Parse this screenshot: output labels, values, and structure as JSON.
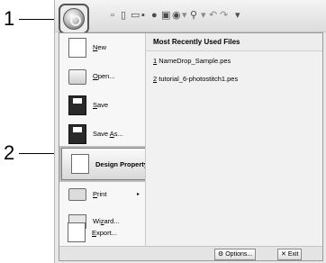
{
  "callouts": {
    "one": "1",
    "two": "2"
  },
  "toolbar": {
    "icons": [
      {
        "name": "new-file-icon",
        "glyph": "🗋"
      },
      {
        "name": "new-doc-icon",
        "glyph": "🗋"
      },
      {
        "name": "open-folder-icon",
        "glyph": "🗁"
      },
      {
        "name": "save-icon",
        "glyph": "💾"
      },
      {
        "name": "stitch-icon",
        "glyph": "◉"
      },
      {
        "name": "pattern-icon",
        "glyph": "▣"
      },
      {
        "name": "thread-icon",
        "glyph": "◍"
      },
      {
        "name": "zoom-icon",
        "glyph": "🔍"
      },
      {
        "name": "undo-icon",
        "glyph": "↶"
      },
      {
        "name": "redo-icon",
        "glyph": "↷"
      },
      {
        "name": "customize-icon",
        "glyph": "▾"
      }
    ]
  },
  "menu": {
    "items": [
      {
        "label": "New",
        "icon": "new-file-icon",
        "underline": "N",
        "rest": "ew"
      },
      {
        "label": "Open...",
        "icon": "open-folder-icon",
        "underline": "O",
        "rest": "pen..."
      },
      {
        "label": "Save",
        "icon": "save-disk-icon",
        "underline": "S",
        "rest": "ave"
      },
      {
        "label": "Save As...",
        "icon": "save-as-icon",
        "pre": "Save ",
        "underline": "A",
        "rest": "s..."
      },
      {
        "label": "Design Property",
        "icon": "design-property-icon"
      },
      {
        "label": "Print",
        "icon": "printer-icon",
        "underline": "P",
        "rest": "rint",
        "arrow": "▸"
      },
      {
        "label": "Wizard...",
        "icon": "wizard-icon",
        "pre": "Wi",
        "underline": "z",
        "rest": "ard..."
      },
      {
        "label": "Export...",
        "icon": "export-icon",
        "underline": "E",
        "rest": "xport..."
      }
    ]
  },
  "recent": {
    "header": "Most Recently Used Files",
    "files": [
      {
        "num": "1",
        "name": " NameDrop_Sample.pes"
      },
      {
        "num": "2",
        "name": " tutorial_6-photostitch1.pes"
      }
    ]
  },
  "footer": {
    "options_label": "Options...",
    "options_underline": "p",
    "exit_label": "Exit",
    "exit_underline": "x"
  }
}
